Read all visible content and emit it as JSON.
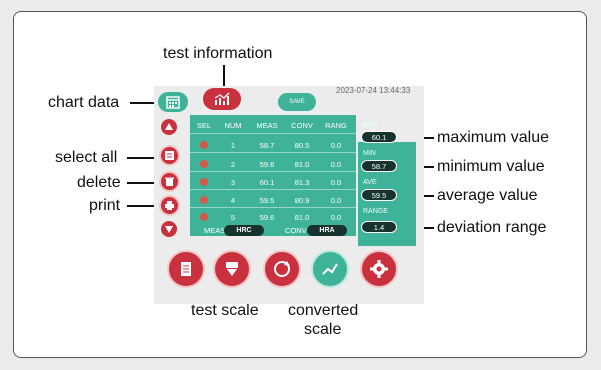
{
  "timestamp": "2023-07-24 13:44:33",
  "save_label": "SAVE",
  "callouts": {
    "test_information": "test information",
    "chart_data": "chart data",
    "select_all": "select all",
    "delete": "delete",
    "print": "print",
    "maximum_value": "maximum value",
    "minimum_value": "minimum value",
    "average_value": "average value",
    "deviation_range": "deviation range",
    "test_scale": "test scale",
    "converted_scale_1": "converted",
    "converted_scale_2": "scale"
  },
  "table": {
    "headers": [
      "SEL",
      "NUM",
      "MEAS",
      "CONV",
      "RANG"
    ],
    "rows": [
      {
        "num": "1",
        "meas": "58.7",
        "conv": "80.5",
        "rang": "0.0"
      },
      {
        "num": "2",
        "meas": "59.6",
        "conv": "81.0",
        "rang": "0.0"
      },
      {
        "num": "3",
        "meas": "60.1",
        "conv": "81.3",
        "rang": "0.0"
      },
      {
        "num": "4",
        "meas": "59.5",
        "conv": "80.9",
        "rang": "0.0"
      },
      {
        "num": "5",
        "meas": "59.6",
        "conv": "81.0",
        "rang": "0.0"
      }
    ]
  },
  "stats": {
    "max_label": "MAX",
    "max_value": "60.1",
    "min_label": "MIN",
    "min_value": "58.7",
    "ave_label": "AVE",
    "ave_value": "59.5",
    "range_label": "RANGE",
    "range_value": "1.4"
  },
  "scales": {
    "meas_label": "MEAS",
    "meas_value": "HRC",
    "conv_label": "CONV",
    "conv_value": "HRA"
  },
  "colors": {
    "accent_red": "#c9313f",
    "teal": "#3fb29a",
    "dark_pill": "#17332d"
  },
  "icons": {
    "chart_data": "calendar-grid-icon",
    "test_information": "trend-chart-icon",
    "scroll_up": "triangle-up-icon",
    "select_all": "checklist-icon",
    "delete": "trash-icon",
    "print": "printer-icon",
    "scroll_down": "triangle-down-icon",
    "bottom": [
      "document-icon",
      "run-download-icon",
      "auto-icon",
      "chart-icon",
      "gear-icon"
    ]
  }
}
